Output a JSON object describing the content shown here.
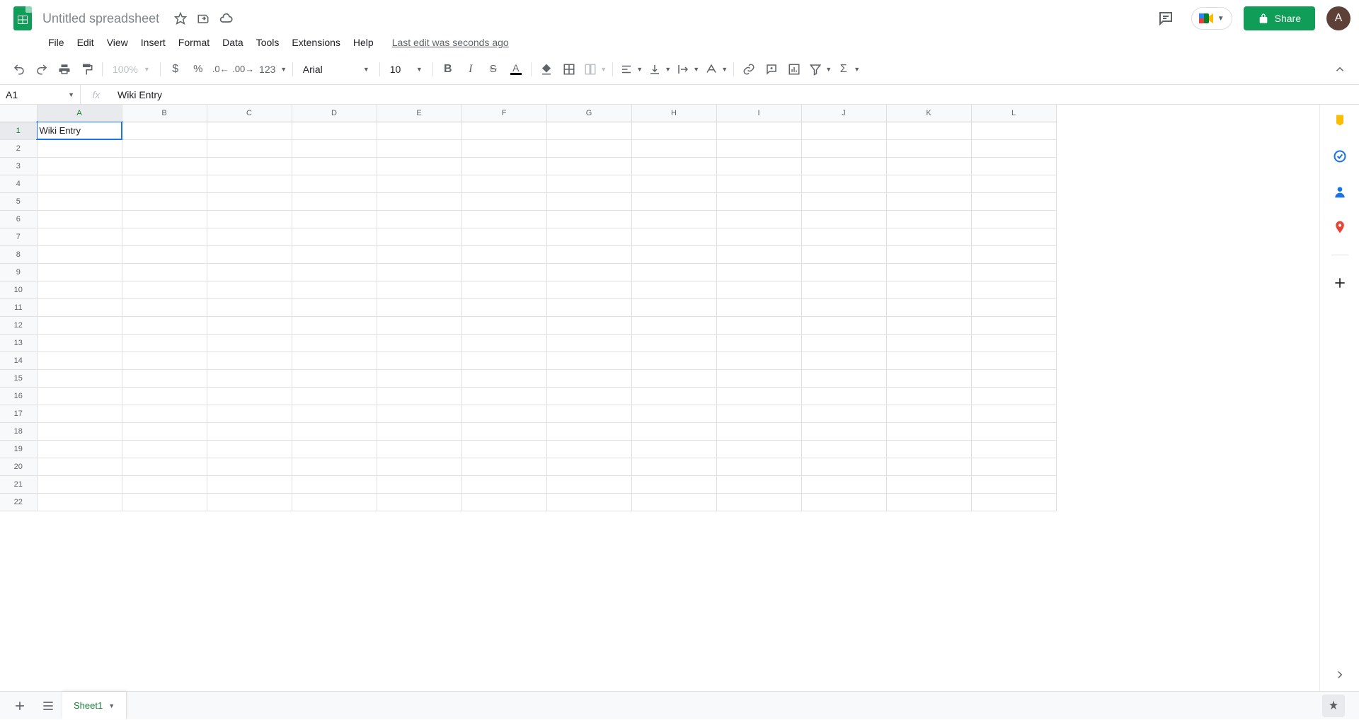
{
  "header": {
    "title": "Untitled spreadsheet",
    "share_label": "Share",
    "avatar_letter": "A"
  },
  "menu": {
    "items": [
      "File",
      "Edit",
      "View",
      "Insert",
      "Format",
      "Data",
      "Tools",
      "Extensions",
      "Help"
    ],
    "last_edit": "Last edit was seconds ago"
  },
  "toolbar": {
    "zoom": "100%",
    "font": "Arial",
    "font_size": "10",
    "number_format": "123"
  },
  "formula_bar": {
    "name_box": "A1",
    "formula": "Wiki Entry"
  },
  "grid": {
    "columns": [
      "A",
      "B",
      "C",
      "D",
      "E",
      "F",
      "G",
      "H",
      "I",
      "J",
      "K",
      "L"
    ],
    "rows": [
      1,
      2,
      3,
      4,
      5,
      6,
      7,
      8,
      9,
      10,
      11,
      12,
      13,
      14,
      15,
      16,
      17,
      18,
      19,
      20,
      21,
      22
    ],
    "active_cell": {
      "row": 1,
      "col": "A"
    },
    "cells": {
      "A1": "Wiki Entry"
    }
  },
  "tabs": {
    "sheet1": "Sheet1"
  }
}
